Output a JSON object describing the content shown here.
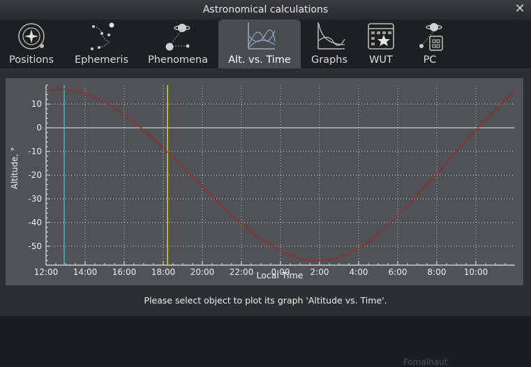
{
  "window": {
    "title": "Astronomical calculations",
    "close_glyph": "✕"
  },
  "tabs": [
    {
      "label": "Positions",
      "icon": "positions-icon",
      "active": false
    },
    {
      "label": "Ephemeris",
      "icon": "ephemeris-icon",
      "active": false
    },
    {
      "label": "Phenomena",
      "icon": "phenomena-icon",
      "active": false
    },
    {
      "label": "Alt. vs. Time",
      "icon": "alt-vs-time-icon",
      "active": true
    },
    {
      "label": "Graphs",
      "icon": "graphs-icon",
      "active": false
    },
    {
      "label": "WUT",
      "icon": "wut-icon",
      "active": false
    },
    {
      "label": "PC",
      "icon": "pc-icon",
      "active": false
    }
  ],
  "background_label": "Fomalhaut",
  "status_text": "Please select object to plot its graph 'Altitude vs. Time'.",
  "colors": {
    "curve": "#9e2a2e",
    "current_time_line": "#3fb8c8",
    "transit_line": "#d8d23a",
    "zero_line": "#e8e8e8",
    "panel": "#505255"
  },
  "chart_data": {
    "type": "line",
    "xlabel": "Local Time",
    "ylabel": "Altitude, °",
    "x_unit": "hours",
    "x_range": [
      12,
      36
    ],
    "x_ticks": [
      "12:00",
      "14:00",
      "16:00",
      "18:00",
      "20:00",
      "22:00",
      "0:00",
      "2:00",
      "4:00",
      "6:00",
      "8:00",
      "10:00"
    ],
    "ylim": [
      -58,
      18
    ],
    "y_ticks": [
      10,
      0,
      -10,
      -20,
      -30,
      -40,
      -50
    ],
    "grid": true,
    "legend": "none",
    "series": [
      {
        "x": [
          12,
          13,
          14,
          15,
          16,
          17,
          18,
          19,
          20,
          21,
          22,
          23,
          24,
          25,
          26,
          27,
          28,
          29,
          30,
          31,
          32,
          33,
          34,
          35,
          36
        ],
        "y": [
          15.8,
          16.2,
          14.5,
          10.8,
          5.5,
          -1.0,
          -8.5,
          -16.5,
          -24.8,
          -33.0,
          -40.5,
          -47.0,
          -52.0,
          -55.3,
          -56.2,
          -54.8,
          -50.8,
          -44.8,
          -37.2,
          -28.5,
          -19.5,
          -10.0,
          -1.0,
          7.8,
          15.5
        ]
      }
    ],
    "markers": [
      {
        "x": 12.93,
        "color": "#3fb8c8"
      },
      {
        "x": 18.22,
        "color": "#d8d23a"
      }
    ]
  }
}
